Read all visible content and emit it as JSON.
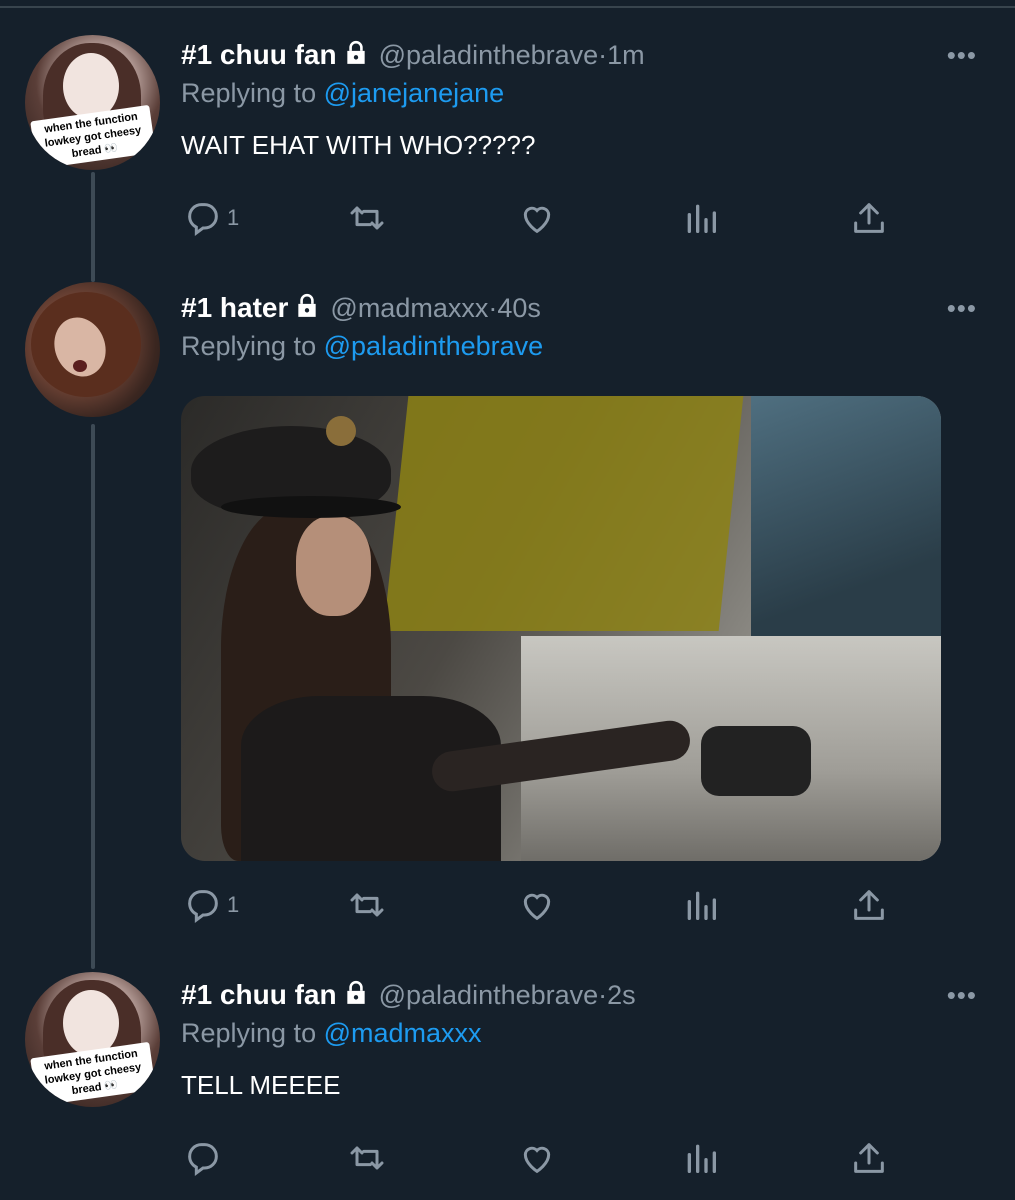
{
  "tweets": [
    {
      "name": "#1 chuu fan",
      "handle": "@paladinthebrave",
      "time": "1m",
      "replying_prefix": "Replying to",
      "replying_to": "@janejanejane",
      "text": "WAIT EHAT WITH WHO?????",
      "avatar_caption": "when the function lowkey got cheesy bread 👀",
      "replies_count": "1",
      "more": "•••"
    },
    {
      "name": "#1 hater",
      "handle": "@madmaxxx",
      "time": "40s",
      "replying_prefix": "Replying to",
      "replying_to": "@paladinthebrave",
      "text": "",
      "media": "pilot-cockpit-video",
      "replies_count": "1",
      "more": "•••"
    },
    {
      "name": "#1 chuu fan",
      "handle": "@paladinthebrave",
      "time": "2s",
      "replying_prefix": "Replying to",
      "replying_to": "@madmaxxx",
      "text": "TELL MEEEE",
      "avatar_caption": "when the function lowkey got cheesy bread 👀",
      "replies_count": "",
      "more": "•••"
    }
  ],
  "separator": " · ",
  "icons": [
    "lock-icon",
    "reply-icon",
    "retweet-icon",
    "like-icon",
    "analytics-icon",
    "share-icon",
    "more-icon"
  ],
  "colors": {
    "background": "#15202b",
    "secondary_text": "#8b98a5",
    "link": "#1d9bf0",
    "thread_line": "#3d4a55"
  }
}
